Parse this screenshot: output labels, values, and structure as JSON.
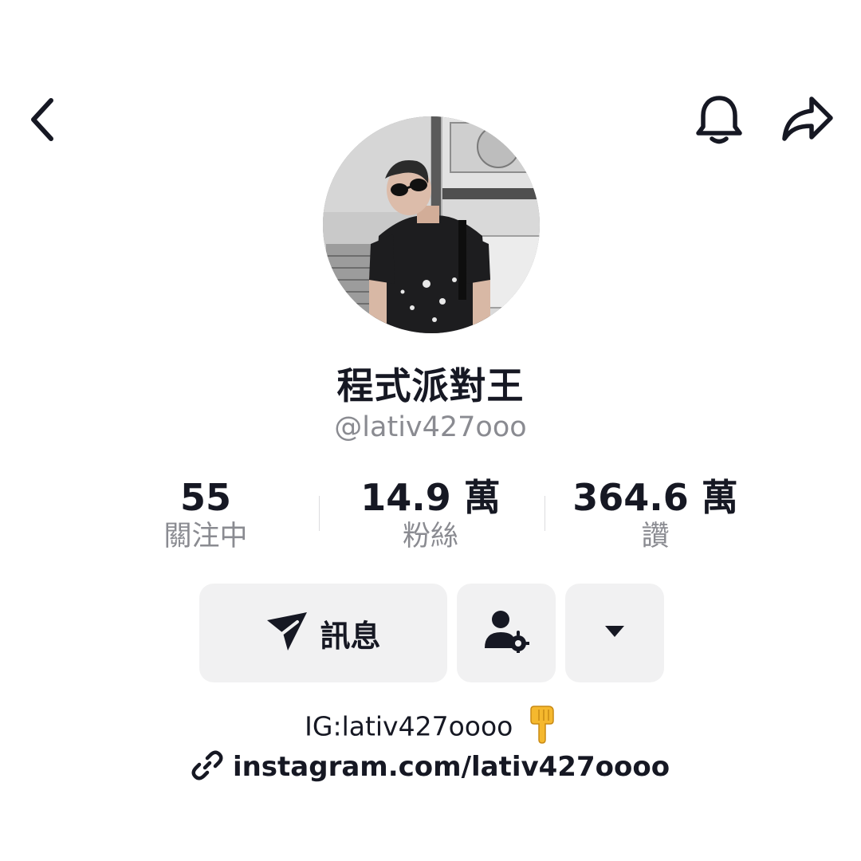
{
  "header": {
    "back_icon": "chevron-left-icon",
    "bell_icon": "bell-icon",
    "share_icon": "share-arrow-icon"
  },
  "profile": {
    "display_name": "程式派對王",
    "username": "@lativ427ooo",
    "avatar_icon": "avatar-photo"
  },
  "stats": [
    {
      "value": "55",
      "label": "關注中"
    },
    {
      "value": "14.9 萬",
      "label": "粉絲"
    },
    {
      "value": "364.6 萬",
      "label": "讚"
    }
  ],
  "actions": {
    "message_label": "訊息",
    "message_icon": "send-icon",
    "friend_icon": "user-settings-icon",
    "more_icon": "caret-down-icon"
  },
  "bio": {
    "text": "IG:lativ427oooo",
    "emoji": "👇",
    "link": "instagram.com/lativ427oooo",
    "link_icon": "link-icon"
  },
  "colors": {
    "text": "#161823",
    "secondary_text": "#8a8b91",
    "button_bg": "#f1f1f2",
    "emoji_fill": "#f5b82e"
  }
}
